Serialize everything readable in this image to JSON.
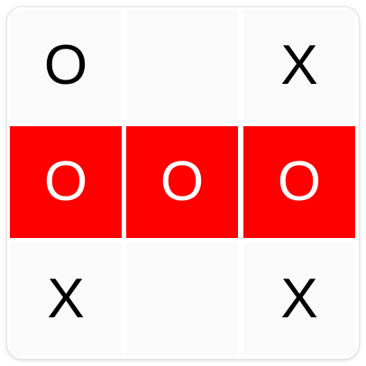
{
  "board": {
    "cells": [
      {
        "mark": "O",
        "winning": false
      },
      {
        "mark": "",
        "winning": false
      },
      {
        "mark": "X",
        "winning": false
      },
      {
        "mark": "O",
        "winning": true
      },
      {
        "mark": "O",
        "winning": true
      },
      {
        "mark": "O",
        "winning": true
      },
      {
        "mark": "X",
        "winning": false
      },
      {
        "mark": "",
        "winning": false
      },
      {
        "mark": "X",
        "winning": false
      }
    ]
  },
  "colors": {
    "win_highlight": "#ff0000",
    "cell_background": "#fafafa",
    "mark": "#000000",
    "win_mark": "#ffffff"
  }
}
